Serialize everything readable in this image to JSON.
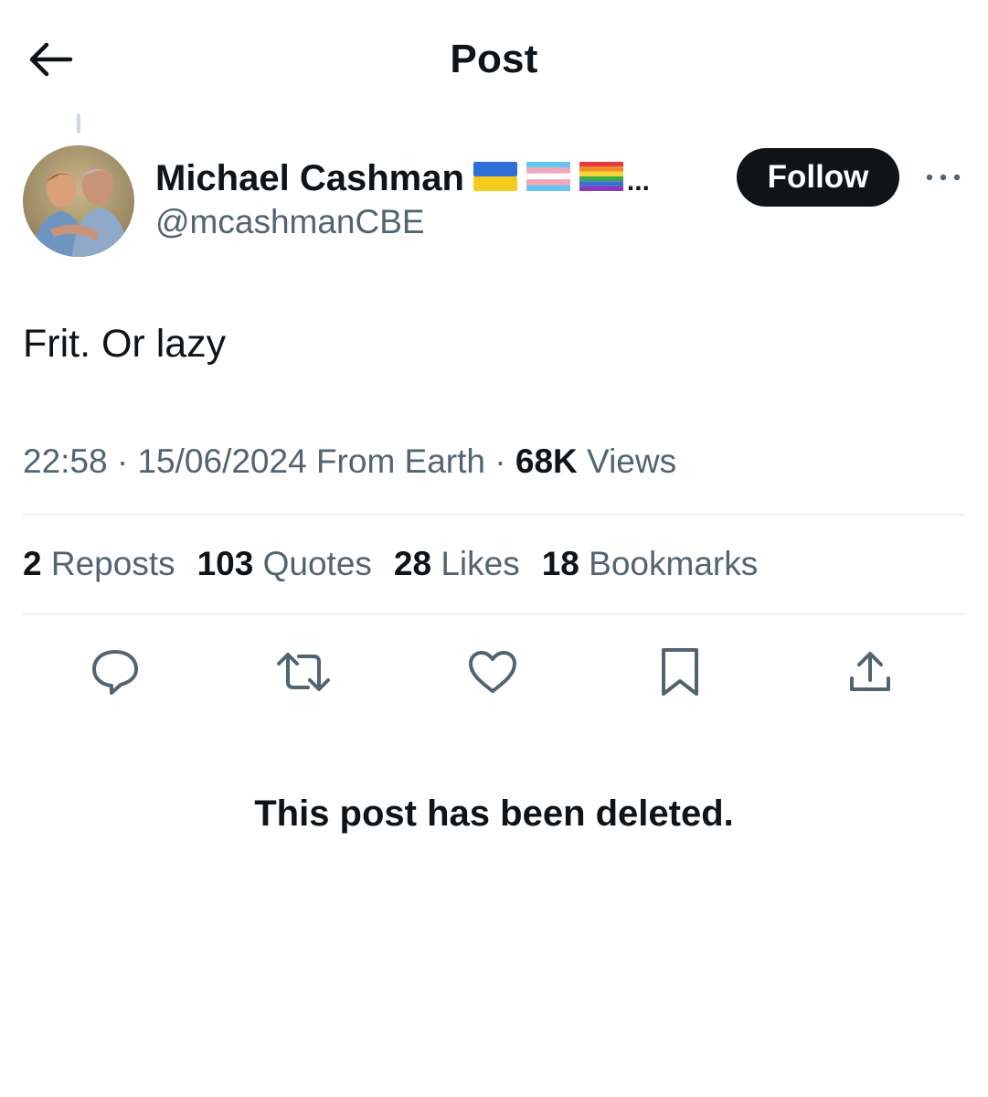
{
  "header": {
    "title": "Post"
  },
  "author": {
    "display_name": "Michael Cashman",
    "name_suffix": "...",
    "handle": "@mcashmanCBE",
    "flags": [
      "ukraine-flag",
      "transgender-flag",
      "rainbow-flag"
    ]
  },
  "follow_label": "Follow",
  "post": {
    "text": "Frit. Or lazy"
  },
  "meta": {
    "time": "22:58",
    "sep1": " · ",
    "date": "15/06/2024",
    "source": " From Earth",
    "sep2": " · ",
    "views_count": "68K",
    "views_label": " Views"
  },
  "stats": [
    {
      "count": "2",
      "label": "Reposts"
    },
    {
      "count": "103",
      "label": "Quotes"
    },
    {
      "count": "28",
      "label": "Likes"
    },
    {
      "count": "18",
      "label": "Bookmarks"
    }
  ],
  "actions": [
    "reply-icon",
    "repost-icon",
    "like-icon",
    "bookmark-icon",
    "share-icon"
  ],
  "deleted_notice": "This post has been deleted.",
  "colors": {
    "text_primary": "#0f1419",
    "text_secondary": "#536471",
    "divider": "#eff3f4",
    "follow_bg": "#0f1419"
  }
}
